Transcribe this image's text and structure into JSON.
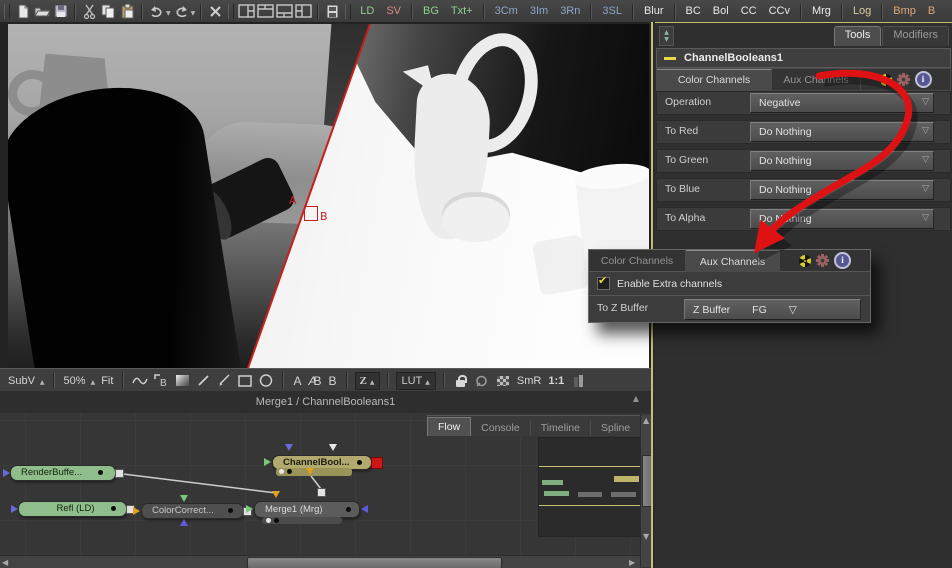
{
  "toolbar": {
    "icons": [
      "new-file",
      "open-file",
      "save-file",
      "cut",
      "copy",
      "paste",
      "undo",
      "redo",
      "delete",
      "layout-a",
      "layout-b",
      "layout-c",
      "layout-d",
      "bin"
    ],
    "buttons": [
      {
        "label": "LD",
        "color": "#8cd08c",
        "sep_after": false
      },
      {
        "label": "SV",
        "color": "#d98a8a",
        "sep_after": true
      },
      {
        "label": "BG",
        "color": "#8cd08c",
        "sep_after": false
      },
      {
        "label": "Txt+",
        "color": "#8cd08c",
        "sep_after": true
      },
      {
        "label": "3Cm",
        "color": "#8ca6c4",
        "sep_after": false
      },
      {
        "label": "3Im",
        "color": "#8ca6c4",
        "sep_after": false
      },
      {
        "label": "3Rn",
        "color": "#8ca6c4",
        "sep_after": true
      },
      {
        "label": "3SL",
        "color": "#8ca6c4",
        "sep_after": true
      },
      {
        "label": "Blur",
        "color": "#e8e8e8",
        "sep_after": true
      },
      {
        "label": "BC",
        "color": "#e8e8e8",
        "sep_after": false
      },
      {
        "label": "Bol",
        "color": "#e8e8e8",
        "sep_after": false
      },
      {
        "label": "CC",
        "color": "#e8e8e8",
        "sep_after": false
      },
      {
        "label": "CCv",
        "color": "#e8e8e8",
        "sep_after": true
      },
      {
        "label": "Mrg",
        "color": "#ececec",
        "sep_after": true
      },
      {
        "label": "Log",
        "color": "#d9c99c",
        "sep_after": true
      },
      {
        "label": "Bmp",
        "color": "#d9a878",
        "sep_after": false
      },
      {
        "label": "B",
        "color": "#d9a878",
        "sep_after": false
      }
    ]
  },
  "viewer": {
    "wipe": {
      "a_label": "A",
      "b_label": "B"
    },
    "toolbar": {
      "subv": "SubV",
      "zoom_level": "50%",
      "fit": "Fit",
      "a": "A",
      "ab": "AB",
      "b": "B",
      "z": "Z",
      "lut": "LUT",
      "smr": "SmR",
      "ratio": "1:1"
    },
    "title": "Merge1 / ChannelBooleans1"
  },
  "flow": {
    "tabs": [
      {
        "label": "Flow",
        "active": true
      },
      {
        "label": "Console",
        "active": false
      },
      {
        "label": "Timeline",
        "active": false
      },
      {
        "label": "Spline",
        "active": false
      }
    ],
    "nodes": [
      {
        "label": "RenderBuffe...",
        "color": "#8fbe8c",
        "text": "#13240f"
      },
      {
        "label": "Refl  (LD)",
        "color": "#8fbe8c",
        "text": "#13240f"
      },
      {
        "label": "ColorCorrect...",
        "color": "#4e4e4e",
        "text": "#c8c8c8"
      },
      {
        "label": "Merge1  (Mrg)",
        "color": "#5c5c5c",
        "text": "#dcdcdc"
      },
      {
        "label": "ChannelBool...",
        "color": "#b1a96d",
        "text": "#1c1c10"
      }
    ]
  },
  "right_panel": {
    "tabs": [
      {
        "label": "Tools",
        "active": true
      },
      {
        "label": "Modifiers",
        "active": false
      }
    ],
    "header": "ChannelBooleans1",
    "channel_tabs": [
      {
        "label": "Color Channels",
        "active": true
      },
      {
        "label": "Aux Channels",
        "active": false
      }
    ],
    "rows": [
      {
        "label": "Operation",
        "value": "Negative"
      },
      {
        "label": "To Red",
        "value": "Do Nothing"
      },
      {
        "label": "To Green",
        "value": "Do Nothing"
      },
      {
        "label": "To Blue",
        "value": "Do Nothing"
      },
      {
        "label": "To Alpha",
        "value": "Do Nothing"
      }
    ]
  },
  "popup": {
    "tabs": [
      {
        "label": "Color Channels",
        "active": false
      },
      {
        "label": "Aux Channels",
        "active": true
      }
    ],
    "checkbox_label": "Enable Extra channels",
    "checkbox_checked": true,
    "row_label": "To Z Buffer",
    "dropdown_value": "Z Buffer",
    "dropdown_option": "FG"
  },
  "colors": {
    "accent_khaki": "#c8bd76",
    "arrow_red": "#de1212",
    "wipe_red": "#c81e1e"
  }
}
